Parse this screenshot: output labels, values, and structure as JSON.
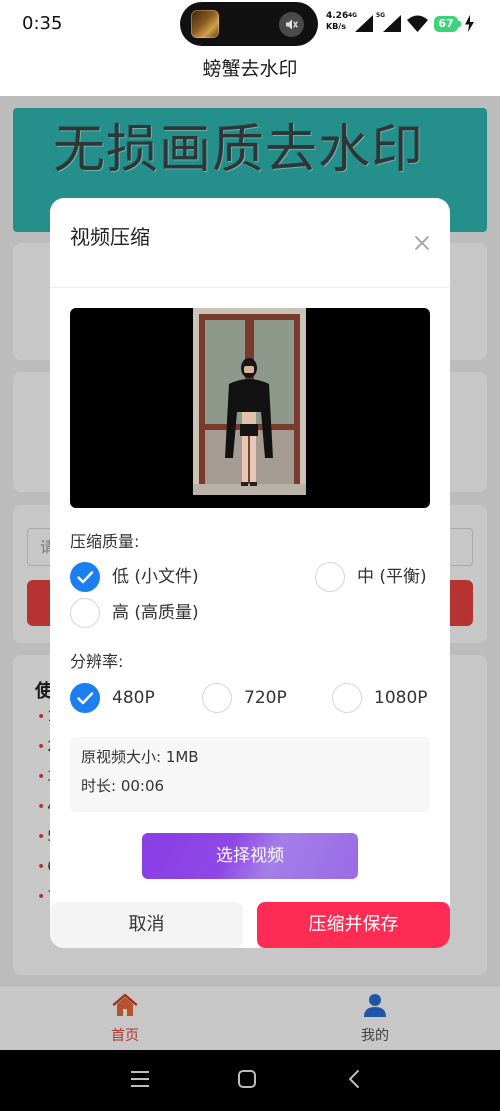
{
  "status_bar": {
    "time": "0:35",
    "net_speed_value": "4.26",
    "net_speed_unit": "KB/s",
    "net1": "4G",
    "net2": "5G",
    "battery": "67"
  },
  "nav": {
    "title": "螃蟹去水印"
  },
  "background": {
    "banner_text": "无损画质去水印",
    "input_placeholder": "请",
    "guide_heading": "使",
    "guide_items": [
      "1",
      "2",
      "3",
      "4",
      "5",
      "6",
      "7"
    ]
  },
  "tabbar": {
    "items": [
      {
        "label": "首页",
        "icon": "home-icon",
        "active": true
      },
      {
        "label": "我的",
        "icon": "user-icon",
        "active": false
      }
    ]
  },
  "modal": {
    "title": "视频压缩",
    "quality_label": "压缩质量:",
    "quality_options": [
      {
        "label": "低 (小文件)",
        "checked": true
      },
      {
        "label": "中 (平衡)",
        "checked": false
      },
      {
        "label": "高 (高质量)",
        "checked": false
      }
    ],
    "resolution_label": "分辨率:",
    "resolution_options": [
      {
        "label": "480P",
        "checked": true
      },
      {
        "label": "720P",
        "checked": false
      },
      {
        "label": "1080P",
        "checked": false
      }
    ],
    "info": {
      "size": "原视频大小: 1MB",
      "duration": "时长: 00:06"
    },
    "select_button": "选择视频",
    "cancel_button": "取消",
    "confirm_button": "压缩并保存"
  },
  "colors": {
    "radio_checked": "#1b7ff0",
    "confirm": "#fe2c55",
    "select_gradient_start": "#8a3de6",
    "select_gradient_end": "#a57ee8",
    "banner": "#2fb8b2",
    "tab_active": "#e8433a",
    "battery": "#3ed37a"
  }
}
